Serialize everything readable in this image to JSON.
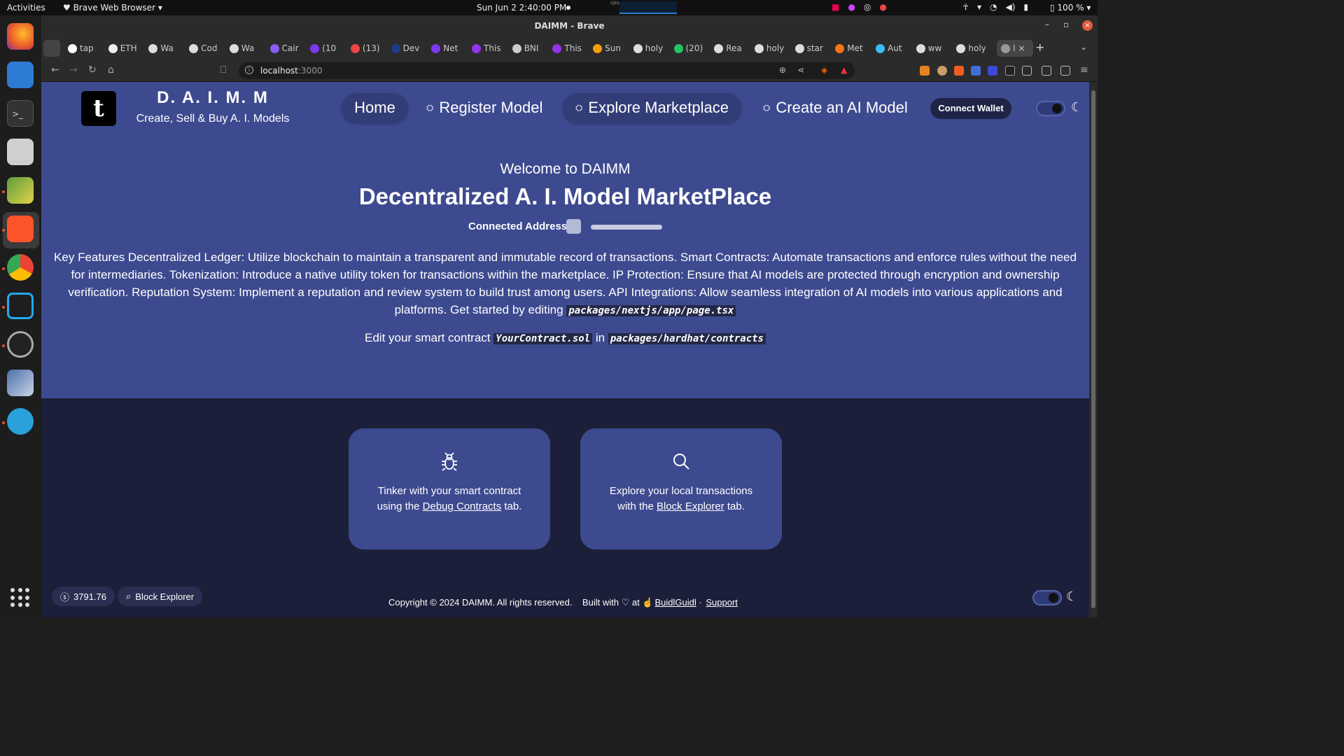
{
  "system": {
    "activities": "Activities",
    "app_menu": "Brave Web Browser",
    "clock": "Sun Jun 2  2:40:00 PM",
    "cpu_label": "cpu",
    "battery": "100 %"
  },
  "browser": {
    "window_title": "DAIMM - Brave",
    "tabs": [
      "tap",
      "ETH",
      "Wa",
      "Cod",
      "Wa",
      "Cair",
      "(10",
      "(13)",
      "Dev",
      "Net",
      "This",
      "BNI",
      "This",
      "Sun",
      "holy",
      "(20)",
      "Rea",
      "holy",
      "star",
      "Met",
      "Aut",
      "ww",
      "holy",
      "l"
    ],
    "url_host": "localhost",
    "url_port": ":3000"
  },
  "header": {
    "logo_glyph": "t",
    "brand_title": "D. A. I. M. M",
    "brand_subtitle": "Create, Sell & Buy A. I. Models",
    "nav": [
      {
        "label": "Home"
      },
      {
        "label": "Register Model"
      },
      {
        "label": "Explore Marketplace"
      },
      {
        "label": "Create an AI Model"
      }
    ],
    "connect_wallet": "Connect Wallet"
  },
  "hero": {
    "welcome": "Welcome to DAIMM",
    "headline": "Decentralized A. I. Model MarketPlace",
    "connected_label": "Connected Address:",
    "description": "Key Features Decentralized Ledger: Utilize blockchain to maintain a transparent and immutable record of transactions. Smart Contracts: Automate transactions and enforce rules without the need for intermediaries. Tokenization: Introduce a native utility token for transactions within the marketplace. IP Protection: Ensure that AI models are protected through encryption and ownership verification. Reputation System: Implement a reputation and review system to build trust among users. API Integrations: Allow seamless integration of AI models into various applications and platforms. Get started by editing",
    "page_path": "packages/nextjs/app/page.tsx",
    "edit_prefix": "Edit your smart contract",
    "contract_file": "YourContract.sol",
    "edit_in": "in",
    "contract_dir": "packages/hardhat/contracts"
  },
  "cards": [
    {
      "icon": "bug-icon",
      "line1": "Tinker with your smart contract",
      "pre": "using the",
      "link": "Debug Contracts",
      "post": "tab."
    },
    {
      "icon": "search-icon",
      "line1": "Explore your local transactions",
      "pre": "with the",
      "link": "Block Explorer",
      "post": "tab."
    }
  ],
  "footer": {
    "balance": "3791.76",
    "block_explorer": "Block Explorer",
    "copyright": "Copyright © 2024 DAIMM. All rights reserved.",
    "built_with": "Built with",
    "at": "at",
    "buidlguidl": "BuidlGuidl",
    "separator": "·",
    "support": "Support"
  },
  "colors": {
    "header_bg": "#3d4a8f",
    "page_bg": "#1c1f3a",
    "card_bg": "#3d4a8f"
  }
}
